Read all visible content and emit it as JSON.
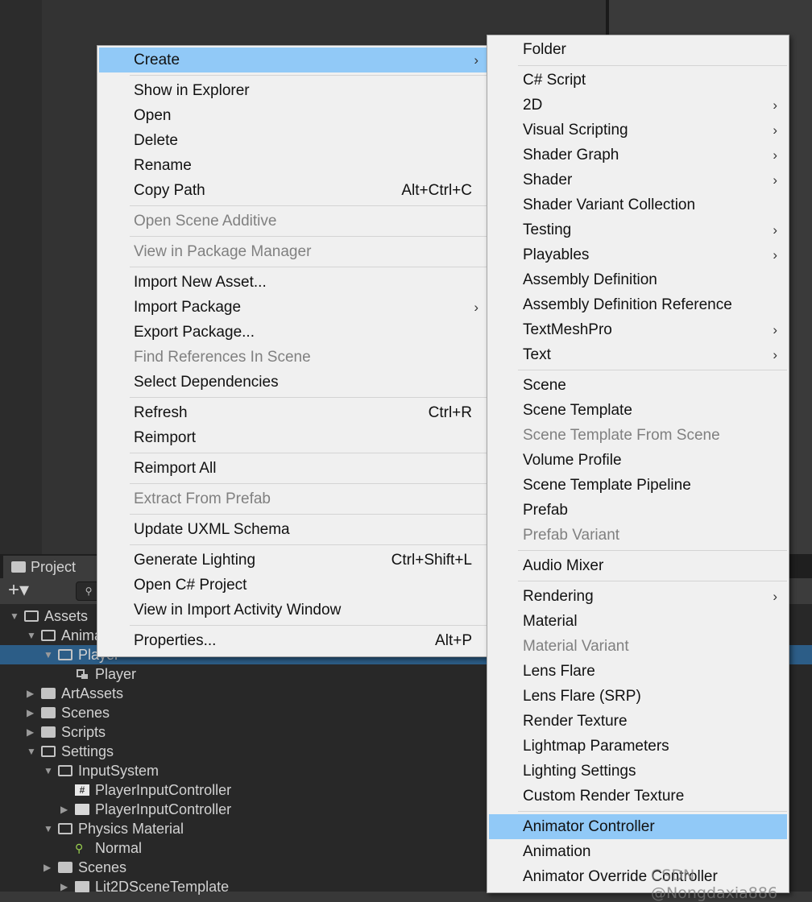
{
  "project_panel": {
    "tab_label": "Project",
    "add_button": "+▾",
    "search_icon": "search-icon",
    "tree": [
      {
        "label": "Assets",
        "icon": "folder-open-icon",
        "arrow": "▼"
      },
      {
        "label": "Anima",
        "icon": "folder-open-icon",
        "arrow": "▼"
      },
      {
        "label": "Player",
        "icon": "folder-open-icon",
        "arrow": "▼",
        "selected": true
      },
      {
        "label": "Player",
        "icon": "animator-icon",
        "arrow": ""
      },
      {
        "label": "ArtAssets",
        "icon": "folder-icon",
        "arrow": "▶"
      },
      {
        "label": "Scenes",
        "icon": "folder-icon",
        "arrow": "▶"
      },
      {
        "label": "Scripts",
        "icon": "folder-icon",
        "arrow": "▶"
      },
      {
        "label": "Settings",
        "icon": "folder-open-icon",
        "arrow": "▼"
      },
      {
        "label": "InputSystem",
        "icon": "folder-open-icon",
        "arrow": "▼"
      },
      {
        "label": "PlayerInputController",
        "icon": "script-icon",
        "arrow": ""
      },
      {
        "label": "PlayerInputController",
        "icon": "input-map-icon",
        "arrow": "▶"
      },
      {
        "label": "Physics Material",
        "icon": "folder-open-icon",
        "arrow": "▼"
      },
      {
        "label": "Normal",
        "icon": "physics-material-icon",
        "arrow": ""
      },
      {
        "label": "Scenes",
        "icon": "folder-icon",
        "arrow": "▶"
      },
      {
        "label": "Lit2DSceneTemplate",
        "icon": "scene-template-icon",
        "arrow": "▶"
      }
    ]
  },
  "context_menu": {
    "items": [
      {
        "label": "Create",
        "submenu": true,
        "highlighted": true
      },
      {
        "label": "Show in Explorer"
      },
      {
        "label": "Open"
      },
      {
        "label": "Delete"
      },
      {
        "label": "Rename"
      },
      {
        "label": "Copy Path",
        "shortcut": "Alt+Ctrl+C"
      },
      {
        "label": "Open Scene Additive",
        "disabled": true
      },
      {
        "label": "View in Package Manager",
        "disabled": true
      },
      {
        "label": "Import New Asset..."
      },
      {
        "label": "Import Package",
        "submenu": true
      },
      {
        "label": "Export Package..."
      },
      {
        "label": "Find References In Scene",
        "disabled": true
      },
      {
        "label": "Select Dependencies"
      },
      {
        "label": "Refresh",
        "shortcut": "Ctrl+R"
      },
      {
        "label": "Reimport"
      },
      {
        "label": "Reimport All"
      },
      {
        "label": "Extract From Prefab",
        "disabled": true
      },
      {
        "label": "Update UXML Schema"
      },
      {
        "label": "Generate Lighting",
        "shortcut": "Ctrl+Shift+L"
      },
      {
        "label": "Open C# Project"
      },
      {
        "label": "View in Import Activity Window"
      },
      {
        "label": "Properties...",
        "shortcut": "Alt+P"
      }
    ]
  },
  "create_submenu": {
    "items": [
      {
        "label": "Folder"
      },
      {
        "label": "C# Script"
      },
      {
        "label": "2D",
        "submenu": true
      },
      {
        "label": "Visual Scripting",
        "submenu": true
      },
      {
        "label": "Shader Graph",
        "submenu": true
      },
      {
        "label": "Shader",
        "submenu": true
      },
      {
        "label": "Shader Variant Collection"
      },
      {
        "label": "Testing",
        "submenu": true
      },
      {
        "label": "Playables",
        "submenu": true
      },
      {
        "label": "Assembly Definition"
      },
      {
        "label": "Assembly Definition Reference"
      },
      {
        "label": "TextMeshPro",
        "submenu": true
      },
      {
        "label": "Text",
        "submenu": true
      },
      {
        "label": "Scene"
      },
      {
        "label": "Scene Template"
      },
      {
        "label": "Scene Template From Scene",
        "disabled": true
      },
      {
        "label": "Volume Profile"
      },
      {
        "label": "Scene Template Pipeline"
      },
      {
        "label": "Prefab"
      },
      {
        "label": "Prefab Variant",
        "disabled": true
      },
      {
        "label": "Audio Mixer"
      },
      {
        "label": "Rendering",
        "submenu": true
      },
      {
        "label": "Material"
      },
      {
        "label": "Material Variant",
        "disabled": true
      },
      {
        "label": "Lens Flare"
      },
      {
        "label": "Lens Flare (SRP)"
      },
      {
        "label": "Render Texture"
      },
      {
        "label": "Lightmap Parameters"
      },
      {
        "label": "Lighting Settings"
      },
      {
        "label": "Custom Render Texture"
      },
      {
        "label": "Animator Controller",
        "highlighted": true
      },
      {
        "label": "Animation"
      },
      {
        "label": "Animator Override Controller"
      }
    ]
  },
  "submenu_arrow": "›",
  "watermark": "CSDN @Nongdaxia886",
  "colors": {
    "highlight": "#91c9f7",
    "selection": "#2c5d87",
    "menu_bg": "#f0f0f0",
    "disabled_text": "#808080"
  }
}
